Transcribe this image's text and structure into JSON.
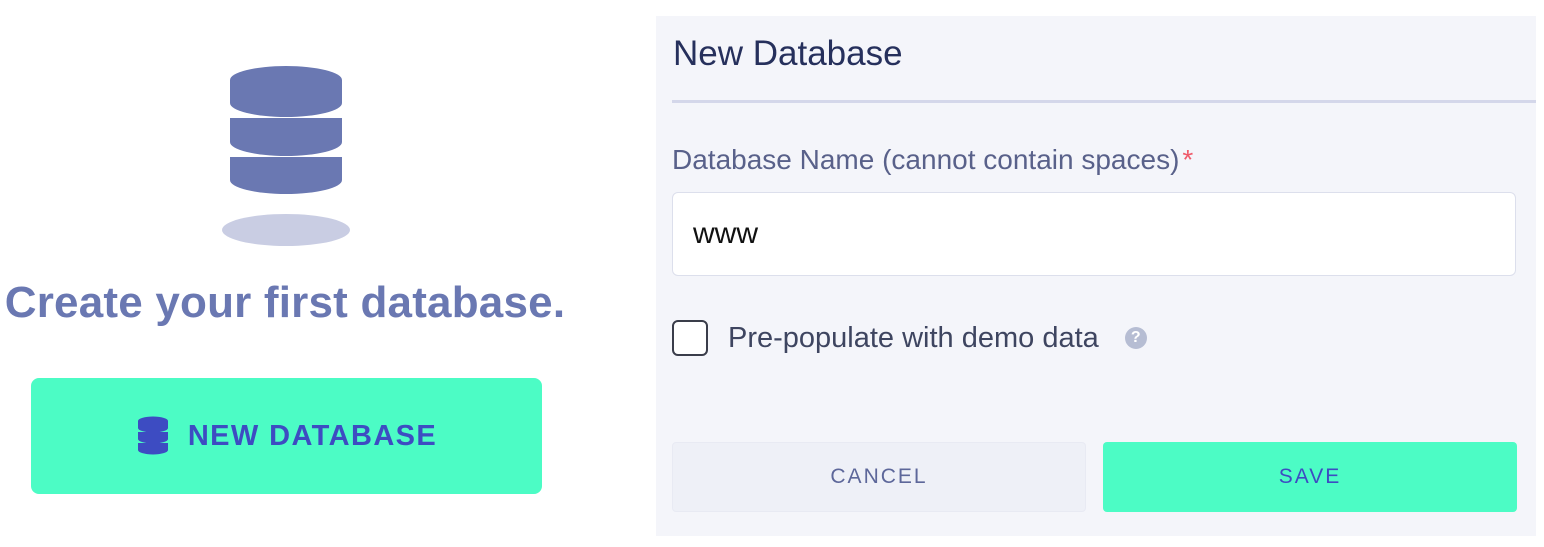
{
  "empty_state": {
    "illustration_icon": "database-icon",
    "title": "Create your first database.",
    "new_button": {
      "icon": "database-icon",
      "label": "NEW DATABASE"
    }
  },
  "dialog": {
    "title": "New Database",
    "name_field": {
      "label": "Database Name (cannot contain spaces)",
      "required_mark": "*",
      "value": "www"
    },
    "demo_checkbox": {
      "label": "Pre-populate with demo data",
      "checked": false,
      "help_icon": "question-circle-icon",
      "help_glyph": "?"
    },
    "cancel_label": "CANCEL",
    "save_label": "SAVE"
  },
  "colors": {
    "accent_green": "#4cfcc5",
    "button_text_blue": "#3d4cc2",
    "illustration_purple": "#6a78b2",
    "dialog_background": "#f4f5fa",
    "required_red": "#ef5a6a"
  }
}
